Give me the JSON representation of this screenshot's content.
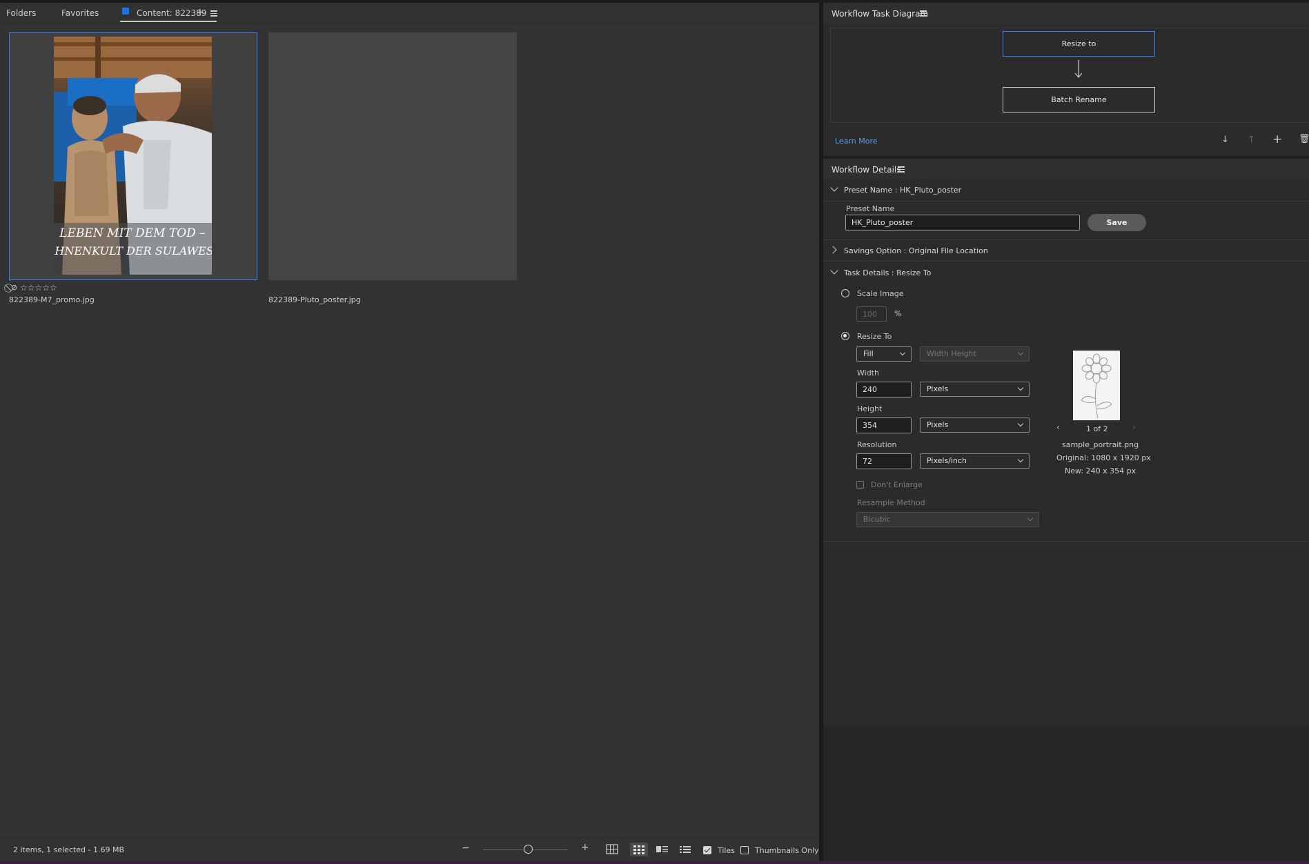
{
  "left_panel": {
    "tabs": {
      "folders": "Folders",
      "favorites": "Favorites",
      "content": "Content: 822389",
      "add_symbol": "+"
    },
    "items": [
      {
        "filename": "822389-M7_promo.jpg",
        "rating_text": "☆☆☆☆☆",
        "selected": true,
        "poster_text_line1": "LEBEN MIT DEM TOD –",
        "poster_text_line2": "AHNENKULT DER SULAWESI"
      },
      {
        "filename": "822389-Pluto_poster.jpg",
        "selected": false
      }
    ],
    "status": {
      "summary": "2 items, 1 selected - 1.69 MB",
      "tiles_label": "Tiles",
      "tiles_checked": true,
      "thumbnails_only_label": "Thumbnails Only",
      "thumbnails_only_checked": false
    }
  },
  "workflow_task_diagram": {
    "title": "Workflow Task Diagram",
    "nodes": [
      "Resize to",
      "Batch Rename"
    ],
    "learn_more": "Learn More"
  },
  "workflow_details": {
    "title": "Workflow Details",
    "preset_section": "Preset Name : HK_Pluto_poster",
    "preset_name_label": "Preset Name",
    "preset_name_value": "HK_Pluto_poster",
    "save_label": "Save",
    "savings_section": "Savings Option : Original File Location",
    "task_section": "Task Details : Resize To",
    "scale_image_label": "Scale Image",
    "scale_value": "100",
    "percent_symbol": "%",
    "resize_to_label": "Resize To",
    "fit_mode": "Fill",
    "dimension_mode": "Width Height",
    "width_label": "Width",
    "width_value": "240",
    "width_unit": "Pixels",
    "height_label": "Height",
    "height_value": "354",
    "height_unit": "Pixels",
    "resolution_label": "Resolution",
    "resolution_value": "72",
    "resolution_unit": "Pixels/inch",
    "dont_enlarge_label": "Don't Enlarge",
    "resample_label": "Resample Method",
    "resample_value": "Bicubic",
    "preview": {
      "pager": "1 of 2",
      "filename": "sample_portrait.png",
      "original": "Original: 1080 x 1920 px",
      "new": "New: 240 x 354 px"
    }
  },
  "colors": {
    "accent_blue": "#3b82f6",
    "link_blue": "#5d9cec",
    "content_tab_swatch": "#1e73e8"
  }
}
